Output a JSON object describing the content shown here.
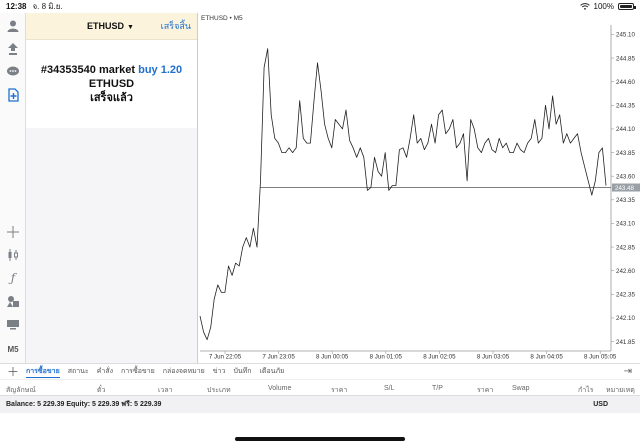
{
  "status_bar": {
    "time": "12:38",
    "date": "จ. 8 มิ.ย.",
    "wifi_icon": "wifi-icon",
    "battery": "100%"
  },
  "left_toolbar": {
    "icons": [
      "user-icon",
      "exchange-icon",
      "chat-icon",
      "new-order-icon",
      "crosshair-icon",
      "candles-icon",
      "function-icon",
      "objects-icon",
      "chart-type-icon"
    ],
    "timeframe": "M5"
  },
  "trade_panel": {
    "symbol": "ETHUSD",
    "done_label": "เสร็จสิ้น",
    "order_line": "#34353540 market",
    "order_action": "buy 1.20",
    "order_symbol": "ETHUSD",
    "order_status": "เสร็จแล้ว"
  },
  "chart": {
    "title": "ETHUSD • M5",
    "current_price": "243.48",
    "colors": {
      "line": "#222222",
      "price_line": "#555555",
      "price_tag_bg": "#9aa0a6",
      "axis_text": "#333333"
    }
  },
  "chart_data": {
    "type": "line",
    "title": "ETHUSD • M5",
    "x_ticks": [
      "7 Jun 22:05",
      "7 Jun 23:05",
      "8 Jun 00:05",
      "8 Jun 01:05",
      "8 Jun 02:05",
      "8 Jun 03:05",
      "8 Jun 04:05",
      "8 Jun 05:05"
    ],
    "y_ticks": [
      "245.10",
      "244.85",
      "244.60",
      "244.35",
      "244.10",
      "243.85",
      "243.60",
      "243.35",
      "243.10",
      "242.85",
      "242.60",
      "242.35",
      "242.10",
      "241.85"
    ],
    "ylim": [
      241.75,
      245.2
    ],
    "current_price": 243.48,
    "series": [
      {
        "values": [
          242.12,
          241.95,
          241.87,
          242.0,
          242.3,
          242.45,
          242.37,
          242.37,
          242.65,
          242.55,
          242.68,
          242.65,
          242.85,
          242.95,
          242.85,
          243.05,
          242.85,
          243.55,
          244.75,
          244.95,
          244.25,
          244.0,
          243.95,
          243.85,
          243.85,
          243.9,
          243.85,
          243.9,
          244.4,
          244.0,
          243.95,
          243.95,
          244.4,
          244.8,
          244.5,
          244.15,
          244.0,
          243.9,
          244.2,
          244.15,
          244.1,
          244.3,
          243.98,
          243.9,
          243.8,
          243.9,
          243.8,
          243.45,
          243.48,
          243.8,
          243.65,
          243.6,
          243.85,
          243.45,
          243.5,
          243.5,
          243.88,
          243.9,
          243.8,
          244.0,
          244.25,
          243.95,
          244.0,
          243.88,
          243.95,
          244.15,
          243.95,
          244.25,
          244.3,
          244.05,
          244.1,
          244.2,
          243.9,
          243.95,
          244.05,
          243.55,
          244.2,
          244.1,
          243.9,
          243.85,
          243.95,
          244.0,
          243.88,
          243.85,
          244.0,
          243.9,
          243.95,
          243.85,
          243.85,
          243.95,
          243.88,
          243.85,
          243.95,
          244.0,
          244.2,
          243.95,
          244.0,
          244.35,
          244.1,
          244.45,
          244.15,
          244.25,
          243.95,
          244.05,
          243.95,
          244.0,
          244.05,
          243.85,
          243.7,
          243.55,
          243.4,
          243.55,
          243.85,
          243.9,
          243.5
        ]
      }
    ]
  },
  "bottom_tabs": {
    "items": [
      "การซื้อขาย",
      "สถานะ",
      "คำสั่ง",
      "การซื้อขาย",
      "กล่องจดหมาย",
      "ข่าว",
      "บันทึก",
      "เตือนภัย"
    ],
    "active_index": 0
  },
  "table_columns": [
    "สัญลักษณ์",
    "ตั๋ว",
    "เวลา",
    "ประเภท",
    "Volume",
    "ราคา",
    "S/L",
    "T/P",
    "ราคา",
    "Swap",
    "กำไร",
    "หมายเหตุ"
  ],
  "balance_row": {
    "summary": "Balance: 5 229.39 Equity: 5 229.39 ฟรี: 5 229.39",
    "currency": "USD"
  }
}
